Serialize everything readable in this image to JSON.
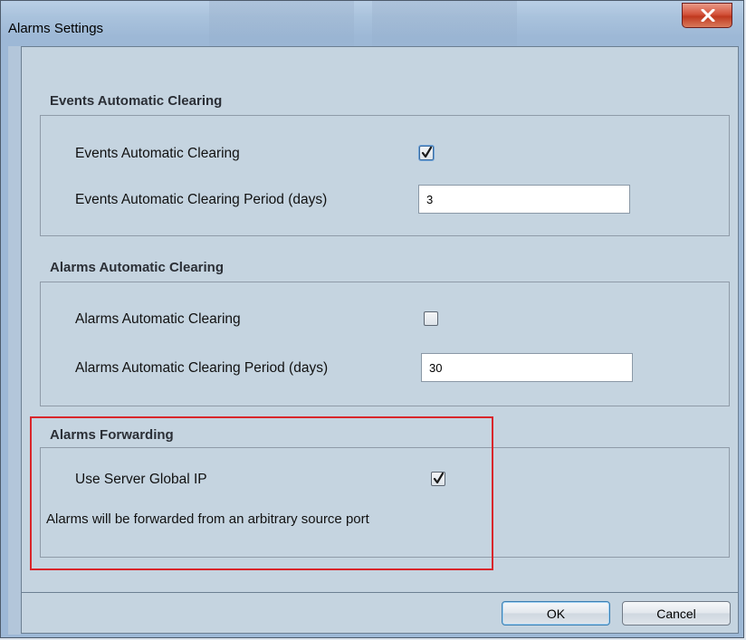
{
  "window": {
    "title": "Alarms Settings"
  },
  "sections": {
    "events": {
      "title": "Events Automatic Clearing",
      "enable_label": "Events Automatic Clearing",
      "enabled": true,
      "period_label": "Events Automatic Clearing Period (days)",
      "period_value": "3"
    },
    "alarms": {
      "title": "Alarms Automatic Clearing",
      "enable_label": "Alarms Automatic Clearing",
      "enabled": false,
      "period_label": "Alarms Automatic Clearing Period (days)",
      "period_value": "30"
    },
    "forwarding": {
      "title": "Alarms Forwarding",
      "global_ip_label": "Use Server Global IP",
      "global_ip_enabled": true,
      "note": "Alarms will be forwarded from an arbitrary source port"
    }
  },
  "buttons": {
    "ok": "OK",
    "cancel": "Cancel"
  },
  "colors": {
    "highlight": "#d9262b",
    "close_button": "#c0391f"
  },
  "icons": {
    "close": "close-icon",
    "check": "checkmark-icon"
  }
}
